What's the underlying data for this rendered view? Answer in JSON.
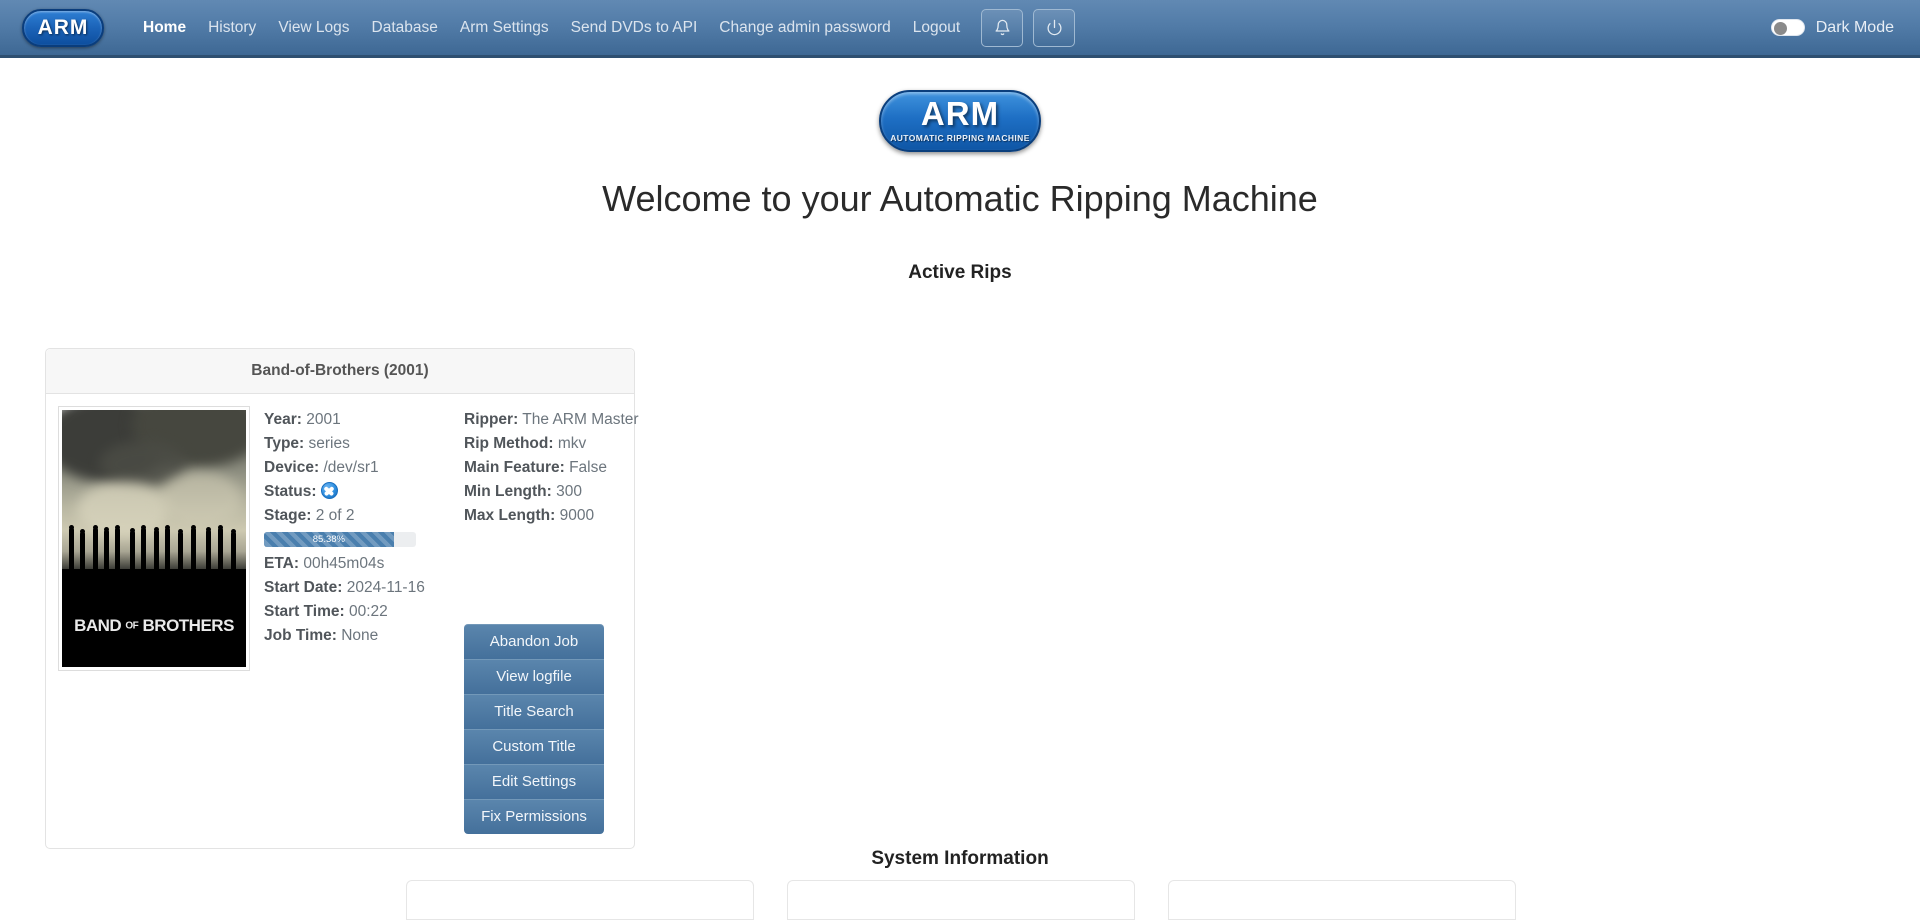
{
  "navbar": {
    "logo_text": "ARM",
    "links": [
      {
        "label": "Home",
        "active": true
      },
      {
        "label": "History",
        "active": false
      },
      {
        "label": "View Logs",
        "active": false
      },
      {
        "label": "Database",
        "active": false
      },
      {
        "label": "Arm Settings",
        "active": false
      },
      {
        "label": "Send DVDs to API",
        "active": false
      },
      {
        "label": "Change admin password",
        "active": false
      },
      {
        "label": "Logout",
        "active": false
      }
    ],
    "notifications_icon": "bell-icon",
    "power_icon": "power-icon",
    "dark_mode_label": "Dark Mode",
    "dark_mode_enabled": false,
    "accent_color": "#527ca8"
  },
  "hero": {
    "logo_big": "ARM",
    "logo_small": "AUTOMATIC RIPPING MACHINE",
    "welcome_heading": "Welcome to your Automatic Ripping Machine"
  },
  "active_rips": {
    "section_title": "Active Rips",
    "job": {
      "title": "Band-of-Brothers (2001)",
      "poster_title_line": "BAND OF BROTHERS",
      "poster_alt": "Band of Brothers poster",
      "left_fields": [
        {
          "label": "Year:",
          "value": "2001"
        },
        {
          "label": "Type:",
          "value": "series"
        },
        {
          "label": "Device:",
          "value": "/dev/sr1"
        }
      ],
      "status": {
        "label": "Status:",
        "icon": "ripping-disc-icon"
      },
      "stage": {
        "label": "Stage:",
        "value": "2 of 2"
      },
      "progress": {
        "percent_text": "85.38%",
        "percent": 85.38
      },
      "left_fields_after": [
        {
          "label": "ETA:",
          "value": "00h45m04s"
        },
        {
          "label": "Start Date:",
          "value": "2024-11-16"
        },
        {
          "label": "Start Time:",
          "value": "00:22"
        },
        {
          "label": "Job Time:",
          "value": "None"
        }
      ],
      "right_fields": [
        {
          "label": "Ripper:",
          "value": "The ARM Master"
        },
        {
          "label": "Rip Method:",
          "value": "mkv"
        },
        {
          "label": "Main Feature:",
          "value": "False"
        },
        {
          "label": "Min Length:",
          "value": "300"
        },
        {
          "label": "Max Length:",
          "value": "9000"
        }
      ],
      "buttons": [
        {
          "label": "Abandon Job"
        },
        {
          "label": "View logfile"
        },
        {
          "label": "Title Search"
        },
        {
          "label": "Custom Title"
        },
        {
          "label": "Edit Settings"
        },
        {
          "label": "Fix Permissions"
        }
      ]
    }
  },
  "system_information": {
    "section_title": "System Information",
    "cards": [
      {},
      {},
      {}
    ]
  }
}
